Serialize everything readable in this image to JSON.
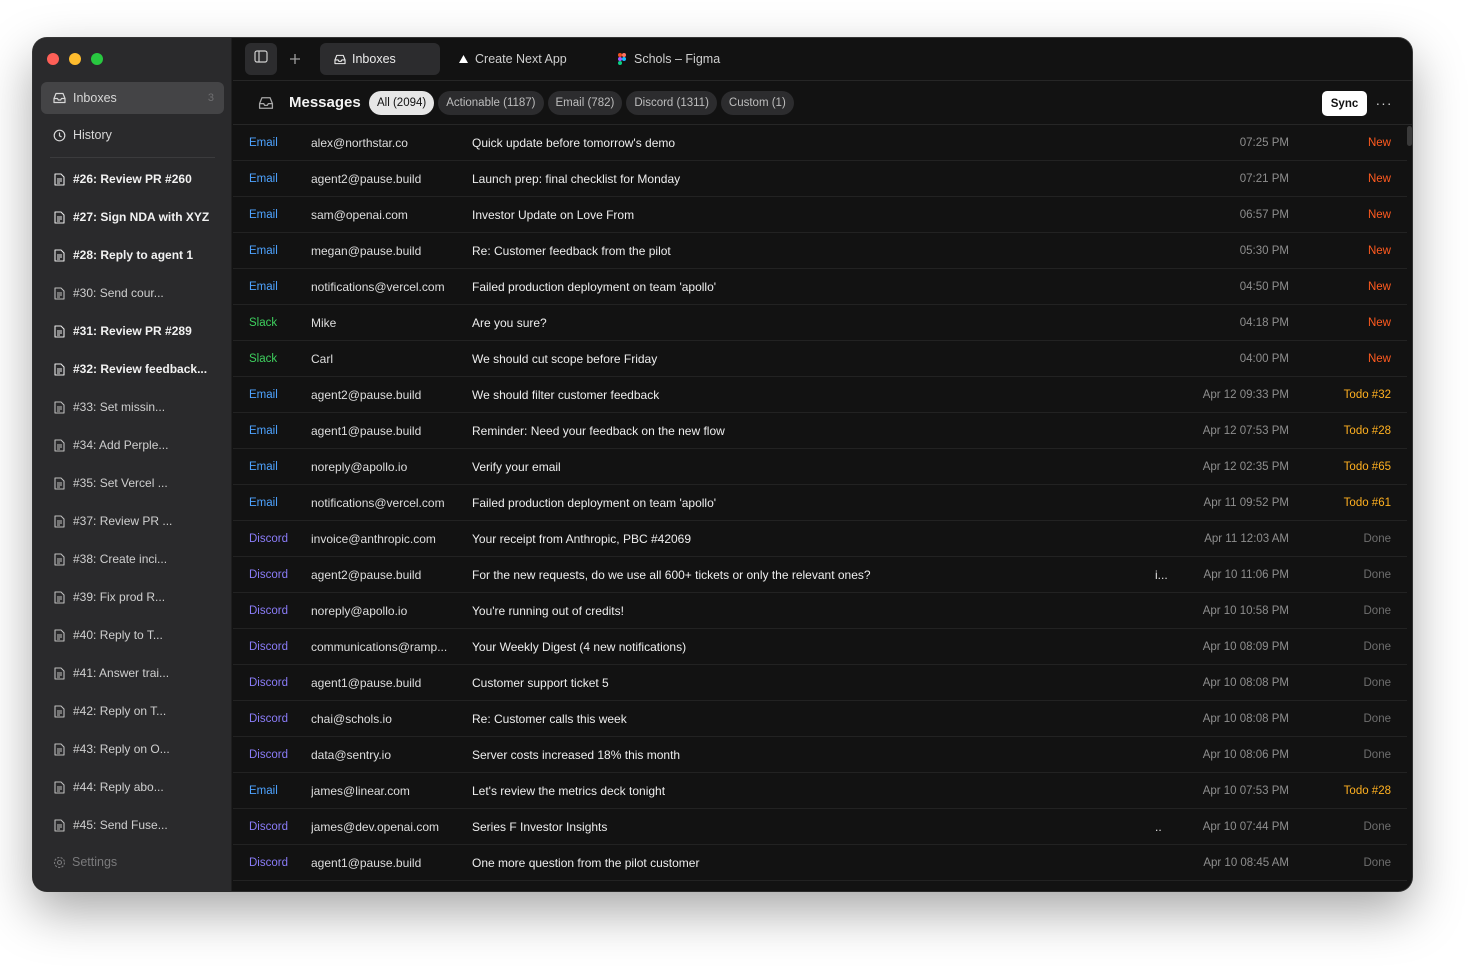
{
  "sidebar": {
    "inbox_label": "Inboxes",
    "inbox_count": "3",
    "history_label": "History",
    "tasks": [
      {
        "label": "#26: Review PR #260",
        "bold": true
      },
      {
        "label": "#27: Sign NDA with XYZ",
        "bold": true
      },
      {
        "label": "#28: Reply to agent 1",
        "bold": true
      },
      {
        "label": "#30: Send cour...",
        "bold": false
      },
      {
        "label": "#31: Review PR #289",
        "bold": true
      },
      {
        "label": "#32: Review feedback...",
        "bold": true
      },
      {
        "label": "#33: Set missin...",
        "bold": false
      },
      {
        "label": "#34: Add Perple...",
        "bold": false
      },
      {
        "label": "#35: Set Vercel ...",
        "bold": false
      },
      {
        "label": "#37: Review PR ...",
        "bold": false
      },
      {
        "label": "#38: Create inci...",
        "bold": false
      },
      {
        "label": "#39: Fix prod R...",
        "bold": false
      },
      {
        "label": "#40: Reply to T...",
        "bold": false
      },
      {
        "label": "#41: Answer trai...",
        "bold": false
      },
      {
        "label": "#42: Reply on T...",
        "bold": false
      },
      {
        "label": "#43: Reply on O...",
        "bold": false
      },
      {
        "label": "#44: Reply abo...",
        "bold": false
      },
      {
        "label": "#45: Send Fuse...",
        "bold": false
      }
    ],
    "settings_label": "Settings"
  },
  "tabs": [
    {
      "label": "Inboxes",
      "icon": "inbox-icon",
      "active": true
    },
    {
      "label": "Create Next App",
      "icon": "vercel-triangle-icon",
      "active": false
    },
    {
      "label": "Schols – Figma",
      "icon": "figma-icon",
      "active": false
    }
  ],
  "header": {
    "title": "Messages",
    "filters": [
      {
        "label": "All (2094)",
        "active": true
      },
      {
        "label": "Actionable (1187)",
        "active": false
      },
      {
        "label": "Email (782)",
        "active": false
      },
      {
        "label": "Discord (1311)",
        "active": false
      },
      {
        "label": "Custom (1)",
        "active": false
      }
    ],
    "sync_label": "Sync",
    "more_label": "···"
  },
  "colors": {
    "email": "#4ea3ff",
    "slack": "#3ecf5e",
    "discord": "#8a7cf7",
    "status_new": "#ff5a1f",
    "status_todo": "#ffb020",
    "status_done": "#6e6e6e"
  },
  "messages": [
    {
      "source": "Email",
      "from": "alex@northstar.co",
      "subject": "Quick update before tomorrow's demo",
      "marker": "",
      "time": "07:25 PM",
      "status": "New",
      "status_type": "new"
    },
    {
      "source": "Email",
      "from": "agent2@pause.build",
      "subject": "Launch prep: final checklist for Monday",
      "marker": "",
      "time": "07:21 PM",
      "status": "New",
      "status_type": "new"
    },
    {
      "source": "Email",
      "from": "sam@openai.com",
      "subject": "Investor Update on Love From",
      "marker": "",
      "time": "06:57 PM",
      "status": "New",
      "status_type": "new"
    },
    {
      "source": "Email",
      "from": "megan@pause.build",
      "subject": "Re: Customer feedback from the pilot",
      "marker": "",
      "time": "05:30 PM",
      "status": "New",
      "status_type": "new"
    },
    {
      "source": "Email",
      "from": "notifications@vercel.com",
      "subject": "Failed production deployment on team 'apollo'",
      "marker": "",
      "time": "04:50 PM",
      "status": "New",
      "status_type": "new"
    },
    {
      "source": "Slack",
      "from": "Mike",
      "subject": "Are you sure?",
      "marker": "",
      "time": "04:18 PM",
      "status": "New",
      "status_type": "new"
    },
    {
      "source": "Slack",
      "from": "Carl",
      "subject": "We should cut scope before Friday",
      "marker": "",
      "time": "04:00 PM",
      "status": "New",
      "status_type": "new"
    },
    {
      "source": "Email",
      "from": "agent2@pause.build",
      "subject": "We should filter customer feedback",
      "marker": "",
      "time": "Apr 12 09:33 PM",
      "status": "Todo #32",
      "status_type": "todo"
    },
    {
      "source": "Email",
      "from": "agent1@pause.build",
      "subject": "Reminder: Need your feedback on the new flow",
      "marker": "",
      "time": "Apr 12 07:53 PM",
      "status": "Todo #28",
      "status_type": "todo"
    },
    {
      "source": "Email",
      "from": "noreply@apollo.io",
      "subject": "Verify your email",
      "marker": "",
      "time": "Apr 12 02:35 PM",
      "status": "Todo #65",
      "status_type": "todo"
    },
    {
      "source": "Email",
      "from": "notifications@vercel.com",
      "subject": "Failed production deployment on team 'apollo'",
      "marker": "",
      "time": "Apr 11 09:52 PM",
      "status": "Todo #61",
      "status_type": "todo"
    },
    {
      "source": "Discord",
      "from": "invoice@anthropic.com",
      "subject": "Your receipt from Anthropic, PBC #42069",
      "marker": "",
      "time": "Apr 11 12:03 AM",
      "status": "Done",
      "status_type": "done"
    },
    {
      "source": "Discord",
      "from": "agent2@pause.build",
      "subject": "For the new requests, do we use all 600+ tickets or only the relevant ones?",
      "marker": "i...",
      "time": "Apr 10 11:06 PM",
      "status": "Done",
      "status_type": "done"
    },
    {
      "source": "Discord",
      "from": "noreply@apollo.io",
      "subject": "You're running out of credits!",
      "marker": "",
      "time": "Apr 10 10:58 PM",
      "status": "Done",
      "status_type": "done"
    },
    {
      "source": "Discord",
      "from": "communications@ramp...",
      "subject": "Your Weekly Digest (4 new notifications)",
      "marker": "",
      "time": "Apr 10 08:09 PM",
      "status": "Done",
      "status_type": "done"
    },
    {
      "source": "Discord",
      "from": "agent1@pause.build",
      "subject": "Customer support ticket 5",
      "marker": "",
      "time": "Apr 10 08:08 PM",
      "status": "Done",
      "status_type": "done"
    },
    {
      "source": "Discord",
      "from": "chai@schols.io",
      "subject": "Re: Customer calls this week",
      "marker": "",
      "time": "Apr 10 08:08 PM",
      "status": "Done",
      "status_type": "done"
    },
    {
      "source": "Discord",
      "from": "data@sentry.io",
      "subject": "Server costs increased 18% this month",
      "marker": "",
      "time": "Apr 10 08:06 PM",
      "status": "Done",
      "status_type": "done"
    },
    {
      "source": "Email",
      "from": "james@linear.com",
      "subject": "Let's review the metrics deck tonight",
      "marker": "",
      "time": "Apr 10 07:53 PM",
      "status": "Todo #28",
      "status_type": "todo"
    },
    {
      "source": "Discord",
      "from": "james@dev.openai.com",
      "subject": "Series F Investor Insights",
      "marker": "..",
      "time": "Apr 10 07:44 PM",
      "status": "Done",
      "status_type": "done"
    },
    {
      "source": "Discord",
      "from": "agent1@pause.build",
      "subject": "One more question from the pilot customer",
      "marker": "",
      "time": "Apr 10 08:45 AM",
      "status": "Done",
      "status_type": "done"
    }
  ]
}
